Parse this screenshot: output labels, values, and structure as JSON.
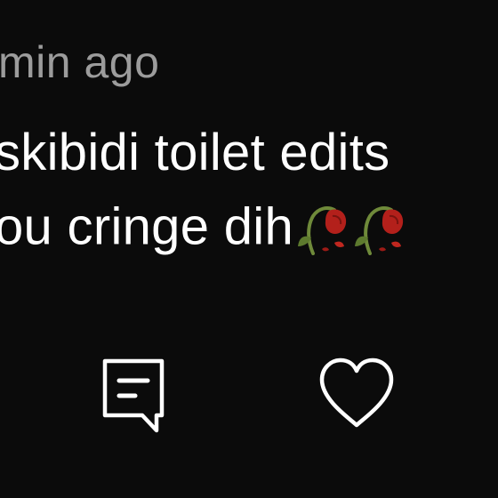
{
  "comment": {
    "timestamp": "min ago",
    "lines": [
      "skibidi toilet edits",
      "ou cringe dih"
    ],
    "emoji": [
      "wilted-flower",
      "wilted-flower"
    ]
  },
  "actions": {
    "reply_icon": "comment-reply-icon",
    "like_icon": "heart-outline-icon"
  },
  "colors": {
    "background": "#0b0b0b",
    "text": "#ffffff",
    "muted_text": "#9c9c9c",
    "petal": "#b3201b"
  }
}
